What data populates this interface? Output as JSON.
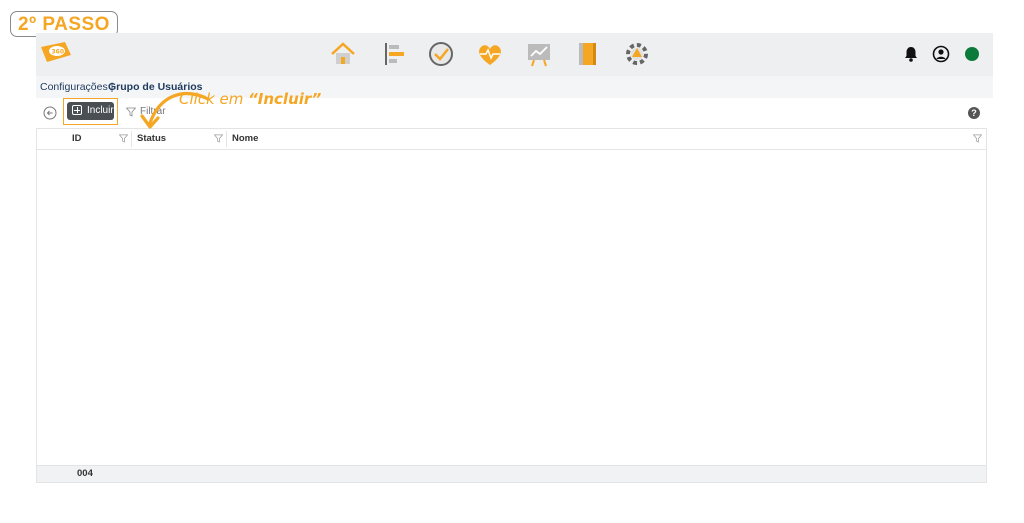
{
  "step_badge": "2º PASSO",
  "callout": {
    "prefix": "Click em ",
    "emphasis": "“Incluir”"
  },
  "breadcrumb": {
    "parent": "Configurações |",
    "current": "Grupo de Usuários"
  },
  "toolbar": {
    "include_label": "Incluir",
    "filter_label": "Filtrar",
    "help": "?"
  },
  "grid": {
    "columns": [
      {
        "label": "ID"
      },
      {
        "label": "Status"
      },
      {
        "label": "Nome"
      }
    ],
    "footer_value": "004"
  },
  "nav_icons": [
    "home-icon",
    "timeline-icon",
    "check-clock-icon",
    "heart-pulse-icon",
    "chart-board-icon",
    "notebook-icon",
    "settings-gear-icon"
  ],
  "colors": {
    "accent": "#f5a623",
    "status_online": "#0b7a3b",
    "button_dark": "#4a4f54"
  }
}
